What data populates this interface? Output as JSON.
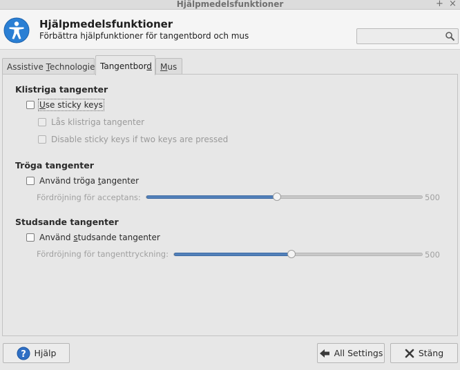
{
  "window": {
    "title": "Hjälpmedelsfunktioner",
    "pin_glyph": "+",
    "close_glyph": "×"
  },
  "header": {
    "title": "Hjälpmedelsfunktioner",
    "subtitle": "Förbättra hjälpfunktioner för tangentbord och mus",
    "search": {
      "value": "",
      "placeholder": ""
    },
    "icon": "accessibility-icon"
  },
  "tabs": [
    {
      "label_before": "Assistive ",
      "mnemonic": "T",
      "label_after": "echnologies",
      "active": false
    },
    {
      "label_before": "Tangentbor",
      "mnemonic": "d",
      "label_after": "",
      "active": true
    },
    {
      "label_before": "",
      "mnemonic": "M",
      "label_after": "us",
      "active": false
    }
  ],
  "sticky": {
    "heading": "Klistriga tangenter",
    "use": {
      "label_before": "",
      "mnemonic": "U",
      "label_after": "se sticky keys",
      "checked": false
    },
    "lock": {
      "label": "Lås klistriga tangenter",
      "checked": false,
      "disabled": true
    },
    "disable_two": {
      "label": "Disable sticky keys if two keys are pressed",
      "checked": false,
      "disabled": true
    }
  },
  "slow": {
    "heading": "Tröga tangenter",
    "use": {
      "label_before": "Använd tröga ",
      "mnemonic": "t",
      "label_after": "angenter",
      "checked": false
    },
    "delay_label": "Fördröjning för acceptans:",
    "value": 500,
    "fraction": 0.473
  },
  "bounce": {
    "heading": "Studsande tangenter",
    "use": {
      "label_before": "Använd ",
      "mnemonic": "s",
      "label_after": "tudsande tangenter",
      "checked": false
    },
    "delay_label": "Fördröjning för tangenttryckning:",
    "value": 500,
    "fraction": 0.473
  },
  "buttons": {
    "help": "Hjälp",
    "all_settings": "All Settings",
    "close": "Stäng"
  },
  "colors": {
    "accent": "#5280b9",
    "help_icon": "#2f6fc4",
    "window_bg": "#e7e7e7"
  }
}
